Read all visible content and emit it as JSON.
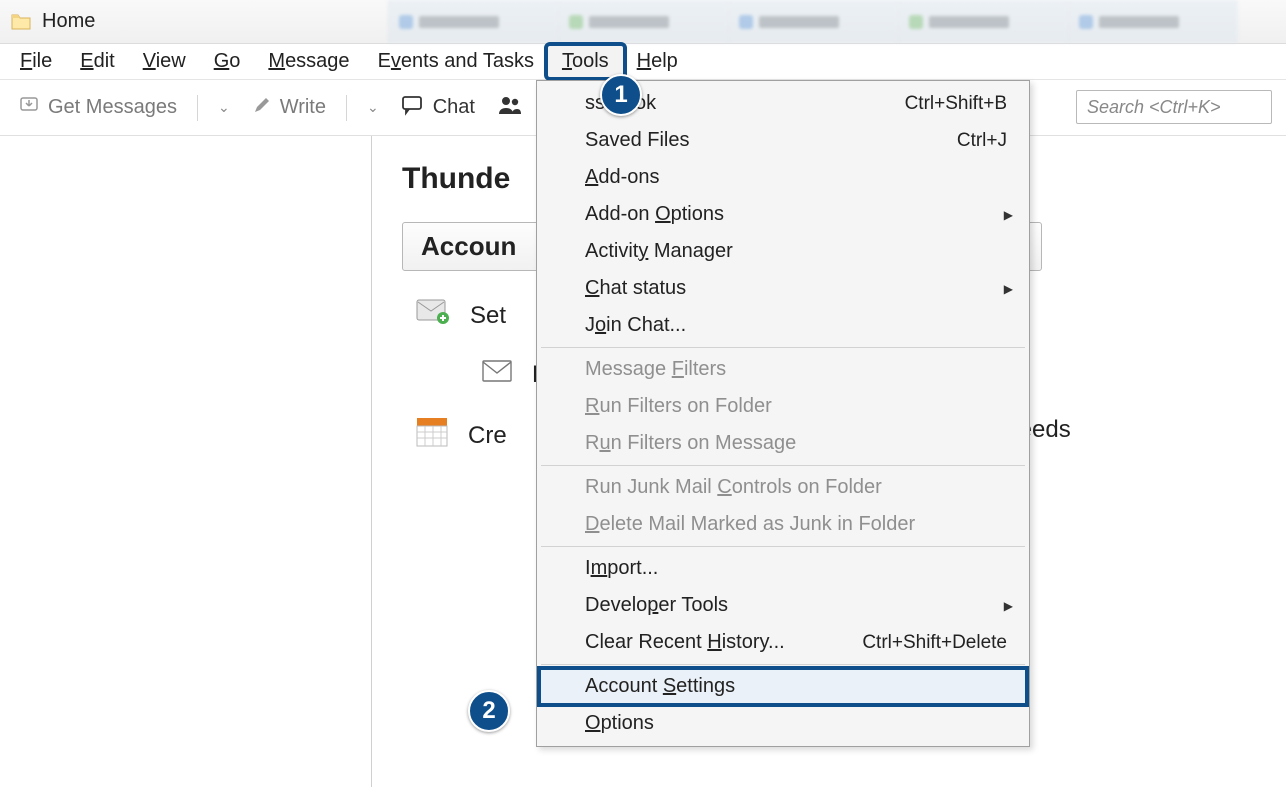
{
  "titlebar": {
    "title": "Home"
  },
  "menubar": {
    "file": "File",
    "edit": "Edit",
    "view": "View",
    "go": "Go",
    "message": "Message",
    "events": "Events and Tasks",
    "tools": "Tools",
    "help": "Help"
  },
  "toolbar": {
    "get_messages": "Get Messages",
    "write": "Write",
    "chat": "Chat"
  },
  "search": {
    "placeholder": "Search <Ctrl+K>"
  },
  "main": {
    "title_partial": "Thunde",
    "accounts_partial": "Accoun",
    "set_partial": "Set",
    "row_e": "E",
    "create_partial": "Cre",
    "feeds": "Feeds"
  },
  "dropdown": {
    "address_book": "ss Book",
    "address_book_sc": "Ctrl+Shift+B",
    "saved_files": "Saved Files",
    "saved_files_sc": "Ctrl+J",
    "addons": "Add-ons",
    "addon_options": "Add-on Options",
    "activity": "Activity Manager",
    "chat_status": "Chat status",
    "join_chat": "Join Chat...",
    "msg_filters": "Message Filters",
    "run_folder": "Run Filters on Folder",
    "run_message": "Run Filters on Message",
    "junk_controls": "Run Junk Mail Controls on Folder",
    "delete_junk": "Delete Mail Marked as Junk in Folder",
    "import": "Import...",
    "dev_tools": "Developer Tools",
    "clear_history": "Clear Recent History...",
    "clear_history_sc": "Ctrl+Shift+Delete",
    "account_settings": "Account Settings",
    "options": "Options"
  },
  "callouts": {
    "one": "1",
    "two": "2"
  }
}
